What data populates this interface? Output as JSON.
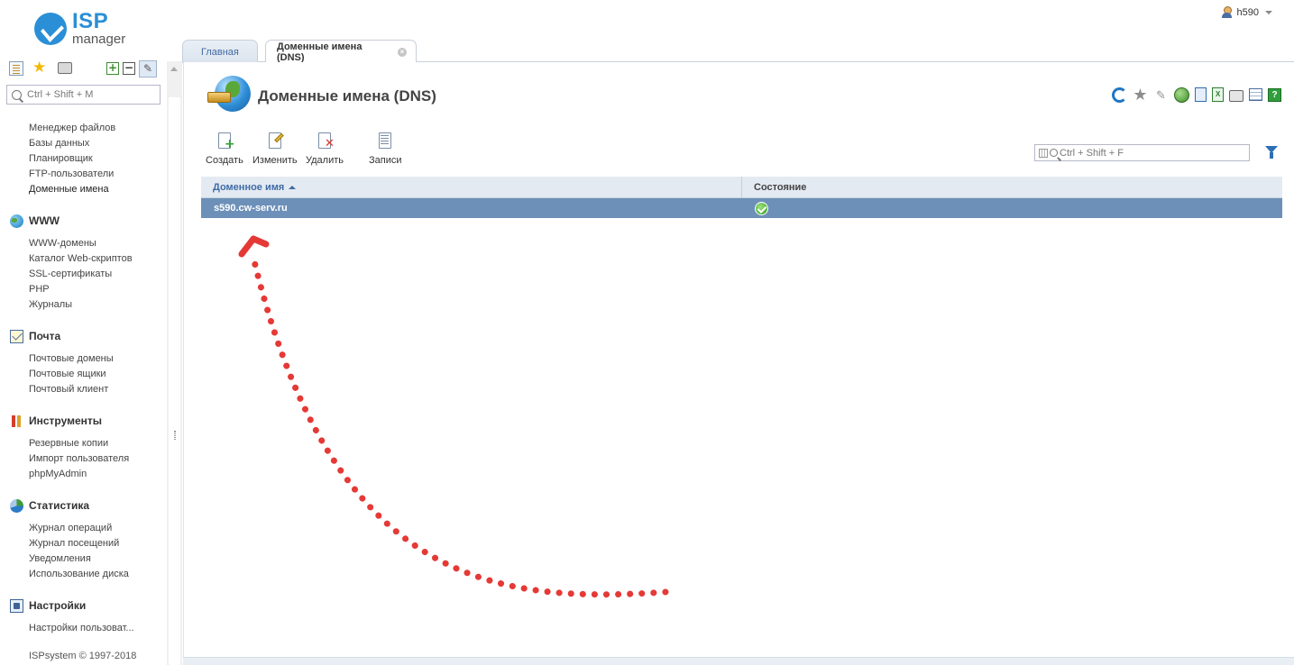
{
  "brand": {
    "top": "ISP",
    "bottom": "manager"
  },
  "user": {
    "name": "h590"
  },
  "sidebar": {
    "search_placeholder": "Ctrl + Shift + M",
    "links_main": [
      "Менеджер файлов",
      "Базы данных",
      "Планировщик",
      "FTP-пользователи",
      "Доменные имена"
    ],
    "sections": [
      {
        "title": "WWW",
        "icon": "globe-icon",
        "items": [
          "WWW-домены",
          "Каталог Web-скриптов",
          "SSL-сертификаты",
          "PHP",
          "Журналы"
        ]
      },
      {
        "title": "Почта",
        "icon": "mail-icon",
        "items": [
          "Почтовые домены",
          "Почтовые ящики",
          "Почтовый клиент"
        ]
      },
      {
        "title": "Инструменты",
        "icon": "tools-icon",
        "items": [
          "Резервные копии",
          "Импорт пользователя",
          "phpMyAdmin"
        ]
      },
      {
        "title": "Статистика",
        "icon": "statistics-icon",
        "items": [
          "Журнал операций",
          "Журнал посещений",
          "Уведомления",
          "Использование диска"
        ]
      },
      {
        "title": "Настройки",
        "icon": "settings-icon",
        "items": [
          "Настройки пользоват..."
        ]
      }
    ],
    "copyright": "ISPsystem © 1997-2018"
  },
  "tabs": [
    {
      "label": "Главная"
    },
    {
      "label": "Доменные имена (DNS)"
    }
  ],
  "page": {
    "title": "Доменные имена (DNS)"
  },
  "toolbar": {
    "create": "Создать",
    "edit": "Изменить",
    "delete": "Удалить",
    "records": "Записи"
  },
  "filter": {
    "placeholder": "Ctrl + Shift + F"
  },
  "table": {
    "columns": [
      "Доменное имя",
      "Состояние"
    ],
    "rows": [
      {
        "domain": "s590.cw-serv.ru",
        "status": "ok"
      }
    ]
  },
  "colors": {
    "accent": "#2a8fd6",
    "selected_row": "#6d90b8",
    "annotation": "#e53935"
  }
}
